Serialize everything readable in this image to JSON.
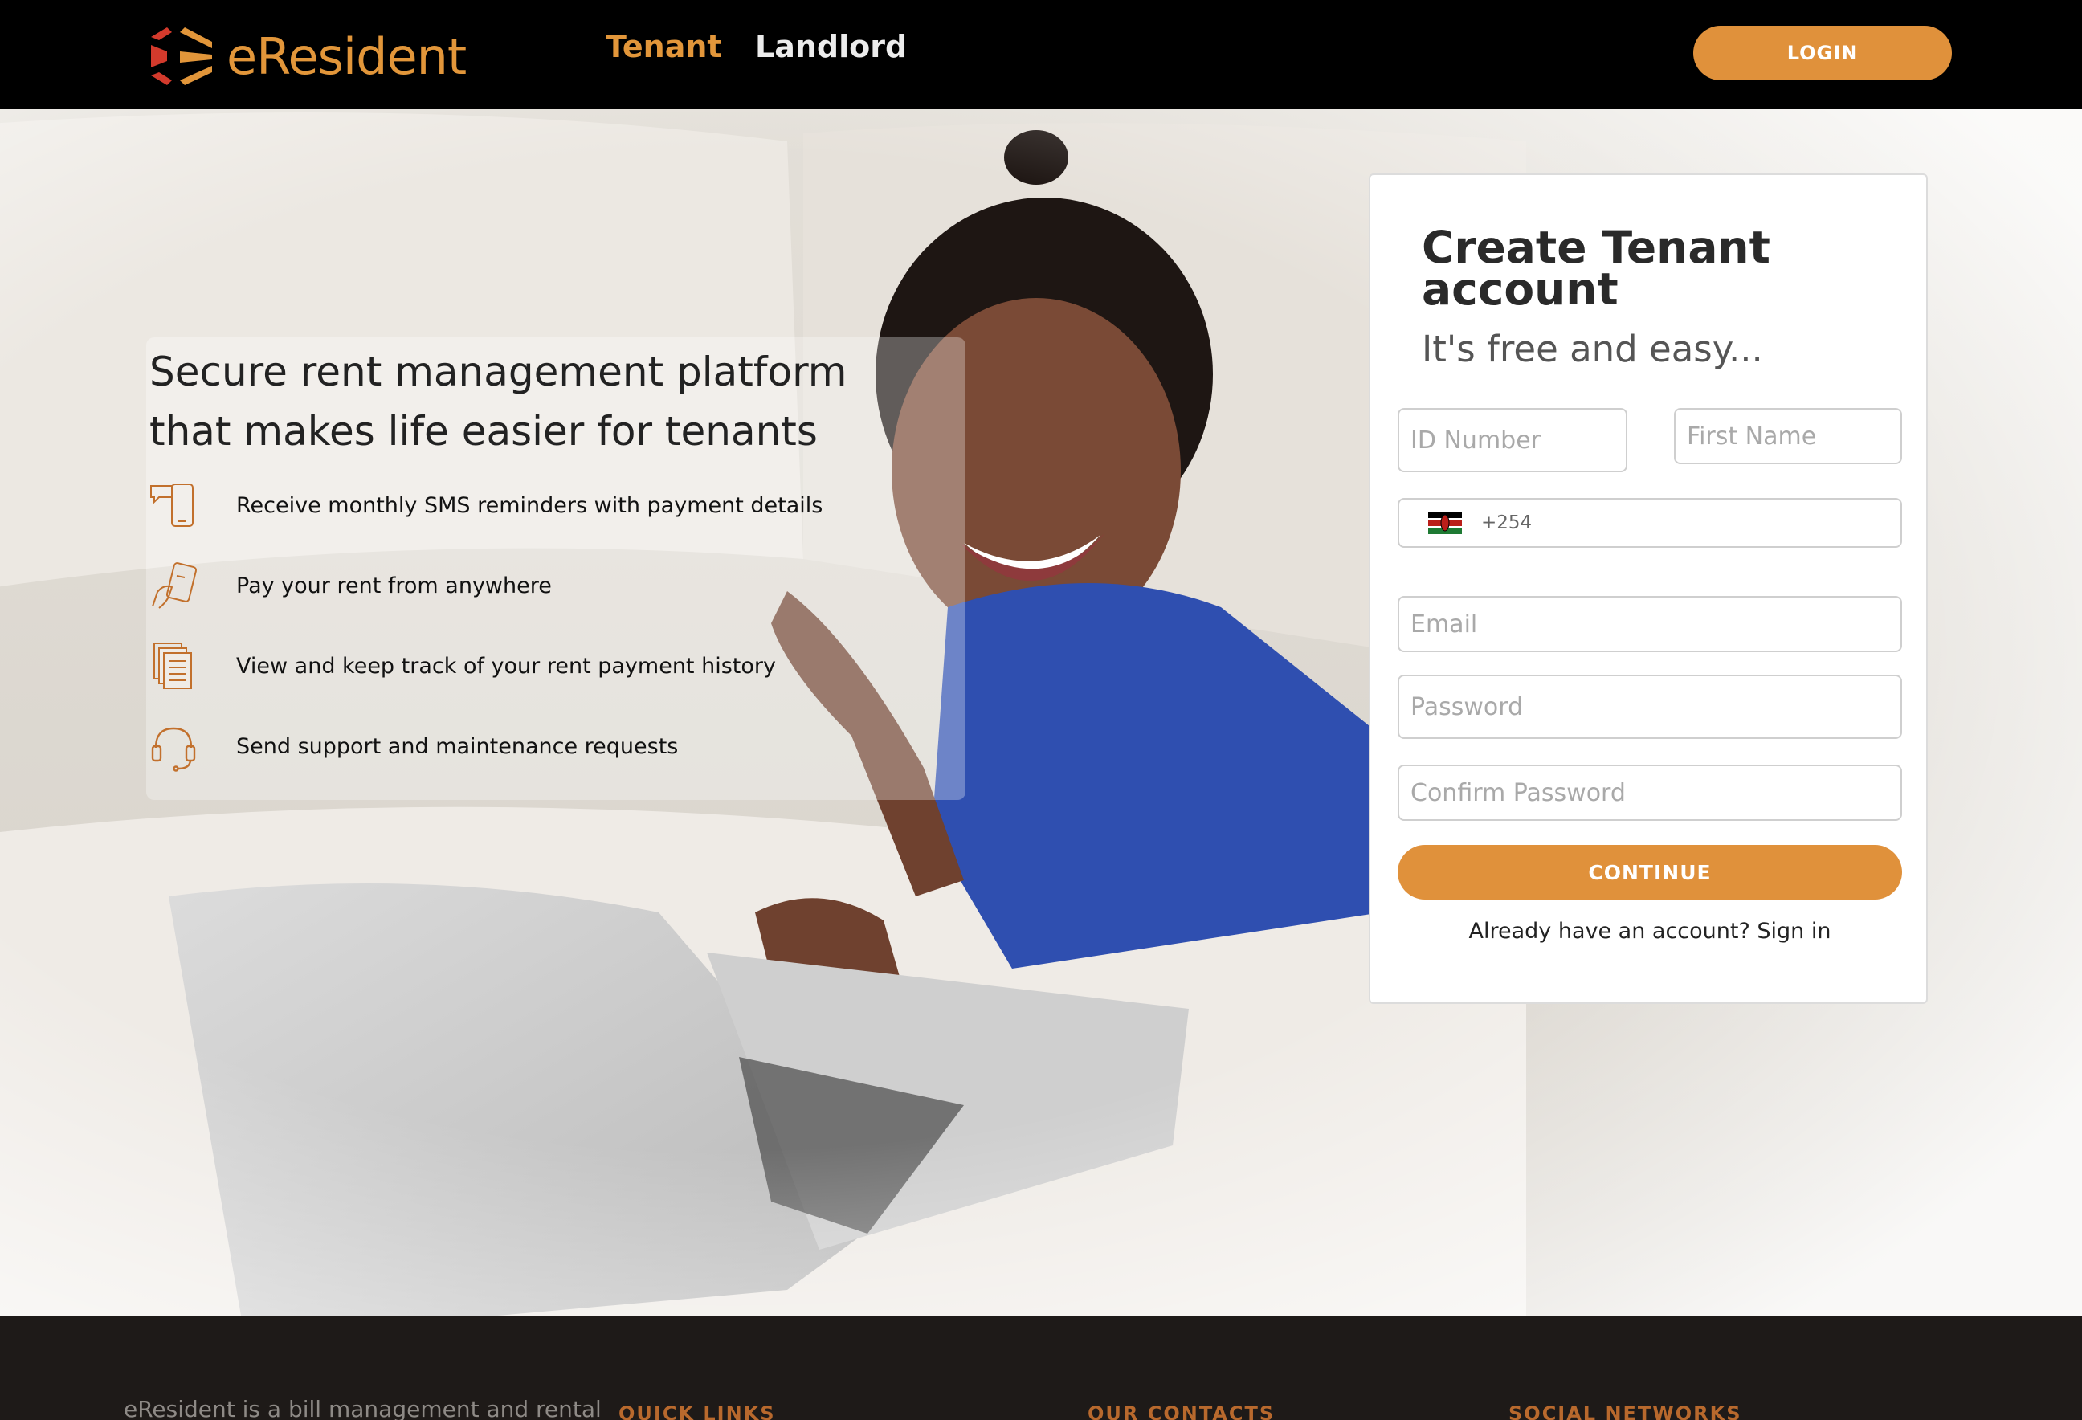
{
  "brand": {
    "name": "eResident",
    "accent_color": "#e2963a",
    "mark_colors": [
      "#d33a2c",
      "#e2963a"
    ]
  },
  "nav": {
    "tenant_label": "Tenant",
    "landlord_label": "Landlord",
    "login_label": "LOGIN"
  },
  "hero": {
    "headline": "Secure rent management platform that makes life easier for tenants",
    "features": [
      {
        "icon": "sms-phone-icon",
        "text": "Receive monthly SMS reminders with payment details"
      },
      {
        "icon": "hand-pay-icon",
        "text": "Pay your rent from anywhere"
      },
      {
        "icon": "documents-icon",
        "text": "View and keep track of your rent payment history"
      },
      {
        "icon": "headset-icon",
        "text": "Send support and maintenance requests"
      }
    ]
  },
  "signup": {
    "title": "Create Tenant account",
    "subtitle": "It's free and easy...",
    "id_placeholder": "ID Number",
    "first_name_placeholder": "First Name",
    "phone_code": "+254",
    "phone_flag": "kenya-flag-icon",
    "email_placeholder": "Email",
    "password_placeholder": "Password",
    "confirm_placeholder": "Confirm Password",
    "continue_label": "CONTINUE",
    "signin_prompt": "Already have an account?",
    "signin_link": "Sign in"
  },
  "footer": {
    "about": "eResident is a bill management and rental",
    "quick_links": "QUICK LINKS",
    "contacts": "OUR CONTACTS",
    "social": "SOCIAL NETWORKS"
  }
}
